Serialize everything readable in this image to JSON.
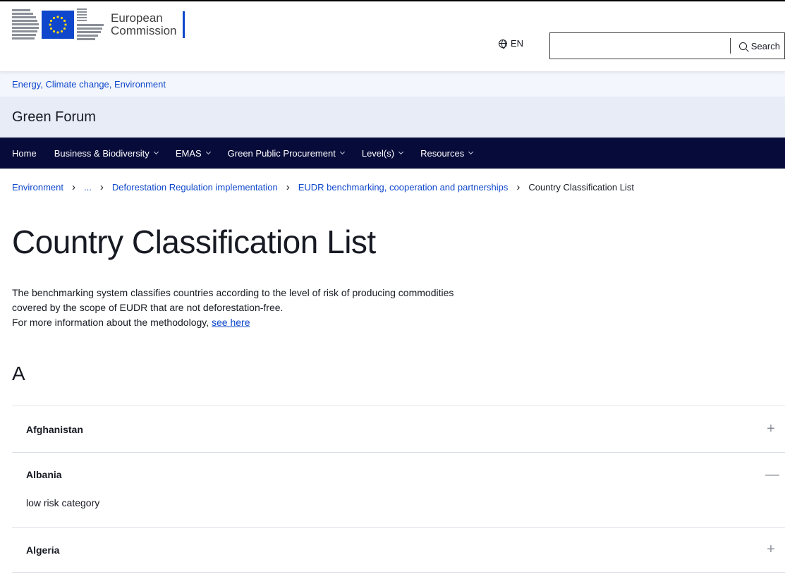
{
  "header": {
    "logo_line1": "European",
    "logo_line2": "Commission",
    "language": "EN",
    "search_value": "",
    "search_button": "Search"
  },
  "site": {
    "context_link": "Energy, Climate change, Environment",
    "name": "Green Forum"
  },
  "nav": {
    "items": [
      {
        "label": "Home",
        "dropdown": false
      },
      {
        "label": "Business & Biodiversity",
        "dropdown": true
      },
      {
        "label": "EMAS",
        "dropdown": true
      },
      {
        "label": "Green Public Procurement",
        "dropdown": true
      },
      {
        "label": "Level(s)",
        "dropdown": true
      },
      {
        "label": "Resources",
        "dropdown": true
      }
    ]
  },
  "breadcrumb": {
    "items": [
      "Environment",
      "...",
      "Deforestation Regulation implementation",
      "EUDR benchmarking, cooperation and partnerships"
    ],
    "current": "Country Classification List"
  },
  "page": {
    "title": "Country Classification List",
    "intro_line1": "The benchmarking system classifies countries according to the level of risk of producing commodities",
    "intro_line2": "covered by the scope of EUDR that are not deforestation-free.",
    "intro_line3": "For more information about the methodology, ",
    "intro_link": "see here",
    "section_letter": "A"
  },
  "accordion": [
    {
      "country": "Afghanistan",
      "expanded": false,
      "toggle": "+",
      "content": ""
    },
    {
      "country": "Albania",
      "expanded": true,
      "toggle": "—",
      "content": "low risk category"
    },
    {
      "country": "Algeria",
      "expanded": false,
      "toggle": "+",
      "content": ""
    }
  ],
  "colors": {
    "brand_blue": "#0e47cb",
    "nav_bg": "#070b3a",
    "context_bg": "#f3f6fc",
    "site_name_bg": "#e7ecf6"
  }
}
